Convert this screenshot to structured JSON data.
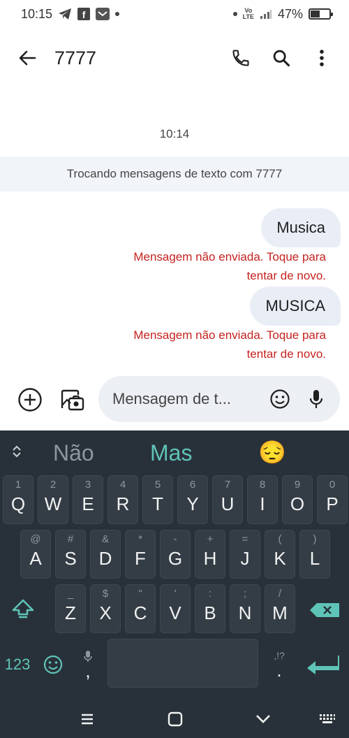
{
  "status_bar": {
    "time": "10:15",
    "battery": "47%",
    "battery_level": 0.47
  },
  "app_bar": {
    "contact": "7777"
  },
  "conversation": {
    "timestamp": "10:14",
    "info": "Trocando mensagens de texto com 7777",
    "messages": [
      {
        "text": "Musica",
        "error_line1": "Mensagem não enviada. Toque para",
        "error_line2": "tentar de novo."
      },
      {
        "text": "MUSICA",
        "error_line1": "Mensagem não enviada. Toque para",
        "error_line2": "tentar de novo."
      }
    ]
  },
  "compose": {
    "placeholder": "Mensagem de t..."
  },
  "keyboard": {
    "suggestions": [
      "Não",
      "Mas",
      "😔"
    ],
    "row1": [
      {
        "hint": "1",
        "key": "Q"
      },
      {
        "hint": "2",
        "key": "W"
      },
      {
        "hint": "3",
        "key": "E"
      },
      {
        "hint": "4",
        "key": "R"
      },
      {
        "hint": "5",
        "key": "T"
      },
      {
        "hint": "6",
        "key": "Y"
      },
      {
        "hint": "7",
        "key": "U"
      },
      {
        "hint": "8",
        "key": "I"
      },
      {
        "hint": "9",
        "key": "O"
      },
      {
        "hint": "0",
        "key": "P"
      }
    ],
    "row2": [
      {
        "hint": "@",
        "key": "A"
      },
      {
        "hint": "#",
        "key": "S"
      },
      {
        "hint": "&",
        "key": "D"
      },
      {
        "hint": "*",
        "key": "F"
      },
      {
        "hint": "-",
        "key": "G"
      },
      {
        "hint": "+",
        "key": "H"
      },
      {
        "hint": "=",
        "key": "J"
      },
      {
        "hint": "(",
        "key": "K"
      },
      {
        "hint": ")",
        "key": "L"
      }
    ],
    "row3": [
      {
        "hint": "_",
        "key": "Z"
      },
      {
        "hint": "$",
        "key": "X"
      },
      {
        "hint": "\"",
        "key": "C"
      },
      {
        "hint": "'",
        "key": "V"
      },
      {
        "hint": ":",
        "key": "B"
      },
      {
        "hint": ";",
        "key": "N"
      },
      {
        "hint": "/",
        "key": "M"
      }
    ],
    "symbols_label": "123",
    "comma": ",",
    "period": ".",
    "punct_hint": ",!?"
  },
  "colors": {
    "accent": "#5fc4b8",
    "error": "#c5221f",
    "keyboard_bg": "#283139",
    "key_bg": "#343d46",
    "bubble": "#e9eef6"
  }
}
